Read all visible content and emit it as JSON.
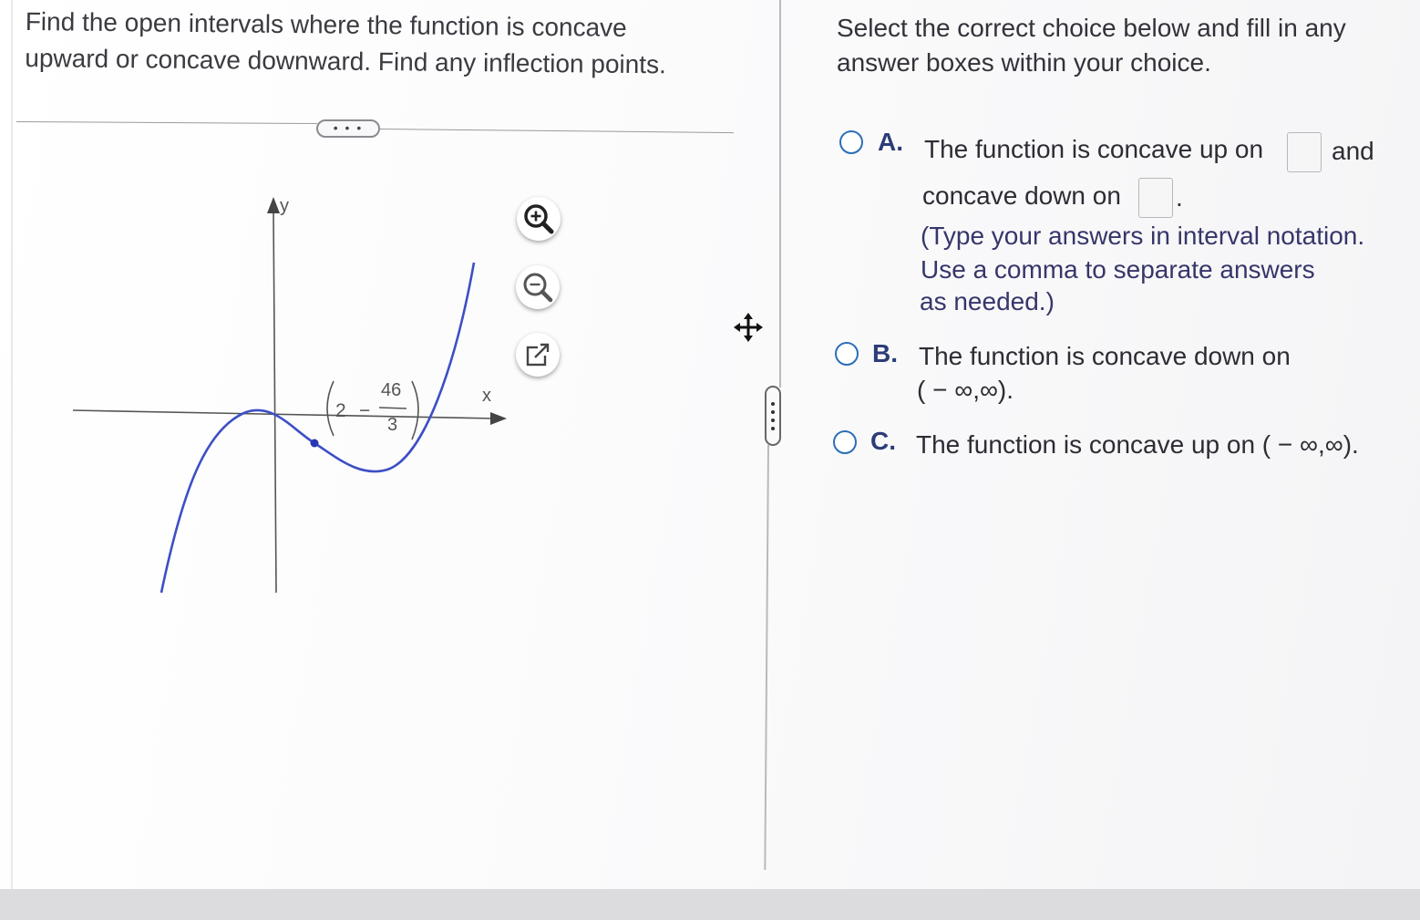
{
  "question": {
    "line1": "Find the open intervals where the function is concave",
    "line2": "upward or concave downward. Find any inflection points."
  },
  "toolbar": {
    "more_label": "• • •"
  },
  "graph": {
    "y_axis_label": "y",
    "x_axis_label": "x",
    "point_x": "2",
    "point_sign": "−",
    "point_numerator": "46",
    "point_denominator": "3",
    "curve_color": "#3d4fc4",
    "point_color": "#2a37b0"
  },
  "graph_tools": {
    "zoom_in": "zoom-in-icon",
    "zoom_out": "zoom-out-icon",
    "popout": "external-link-icon"
  },
  "instructions": {
    "line1": "Select the correct choice below and fill in any",
    "line2": "answer boxes within your choice."
  },
  "choices": {
    "a": {
      "letter": "A.",
      "text1": "The function is concave up on",
      "text2": "and",
      "text3": "concave down on",
      "text4": ".",
      "hint1": "(Type your answers in interval notation.",
      "hint2": "Use a comma to separate answers",
      "hint3": "as needed.)",
      "concave_up_value": "",
      "concave_down_value": ""
    },
    "b": {
      "letter": "B.",
      "text1": "The function is concave down on",
      "text2": "( − ∞,∞)."
    },
    "c": {
      "letter": "C.",
      "text1": "The function is concave up on ( − ∞,∞)."
    }
  },
  "colors": {
    "radio_border": "#2b6fb8",
    "letter": "#2c3c78"
  }
}
